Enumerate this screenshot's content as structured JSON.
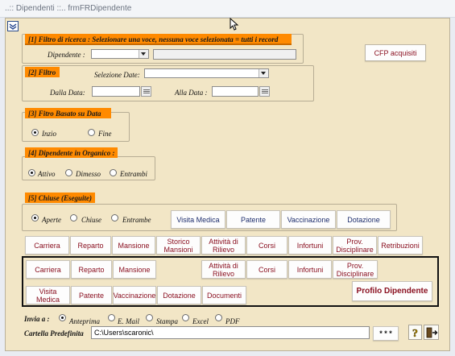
{
  "window": {
    "title": "..:: Dipendenti ::..   frmFRDipendente"
  },
  "section1": {
    "header": "[1] Filtro di ricerca :  Selezionare una voce, nessuna voce selezionata = tutti i record",
    "dipendente_label": "Dipendente :",
    "dipendente_value": "",
    "dipendente_text": ""
  },
  "section2": {
    "header": "[2] Filtro",
    "selezione_label": "Selezione Date:",
    "selezione_value": "",
    "dalla_label": "Dalla Data:",
    "dalla_value": "",
    "alla_label": "Alla Data :",
    "alla_value": ""
  },
  "section3": {
    "header": "[3] Fitro Basato su Data",
    "options": [
      {
        "label": "Inzio",
        "selected": true
      },
      {
        "label": "Fine",
        "selected": false
      }
    ]
  },
  "section4": {
    "header": "[4] Dipendente in Organico :",
    "options": [
      {
        "label": "Attivo",
        "selected": true
      },
      {
        "label": "Dimesso",
        "selected": false
      },
      {
        "label": "Entrambi",
        "selected": false
      }
    ]
  },
  "section5": {
    "header": "[5] Chiuse (Eseguite)",
    "options": [
      {
        "label": "Aperte",
        "selected": true
      },
      {
        "label": "Chiuse",
        "selected": false
      },
      {
        "label": "Entrambe",
        "selected": false
      }
    ],
    "buttons": [
      "Visita Medica",
      "Patente",
      "Vaccinazione",
      "Dotazione"
    ]
  },
  "cfp_button": "CFP acquisiti",
  "row1": [
    "Carriera",
    "Reparto",
    "Mansione",
    "Storico Mansioni",
    "Attività di Rilievo",
    "Corsi",
    "Infortuni",
    "Prov. Disciplinare",
    "Retribuzioni"
  ],
  "row2": [
    "Carriera",
    "Reparto",
    "Mansione",
    "Attività di Rilievo",
    "Corsi",
    "Infortuni",
    "Prov. Disciplinare"
  ],
  "row3": [
    "Visita Medica",
    "Patente",
    "Vaccinazione",
    "Dotazione",
    "Documenti"
  ],
  "profilo_button": "Profilo Dipendente",
  "invia": {
    "label": "Invia a :",
    "options": [
      {
        "label": "Anteprima",
        "selected": true
      },
      {
        "label": "E. Mail",
        "selected": false
      },
      {
        "label": "Stampa",
        "selected": false
      },
      {
        "label": "Excel",
        "selected": false
      },
      {
        "label": "PDF",
        "selected": false
      }
    ]
  },
  "cartella": {
    "label": "Cartella Predefinita",
    "value": "C:\\Users\\scaronic\\",
    "browse_label": "* * *"
  },
  "colors": {
    "header_orange": "#ff8a00",
    "form_bg": "#f2e6c6",
    "button_text": "#8a1020",
    "button_text_blue": "#1f2f6e"
  }
}
